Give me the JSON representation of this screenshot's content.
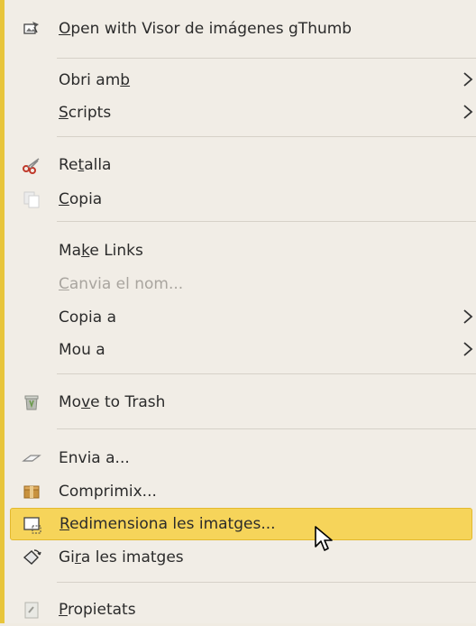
{
  "menu": {
    "items": [
      {
        "pre": "",
        "u": "O",
        "post": "pen with Visor de imágenes gThumb",
        "icon": "gthumb-icon"
      },
      {
        "pre": "Obri am",
        "u": "b",
        "post": "",
        "submenu": true
      },
      {
        "pre": "",
        "u": "S",
        "post": "cripts",
        "submenu": true
      },
      {
        "pre": "Re",
        "u": "t",
        "post": "alla",
        "icon": "scissors-icon"
      },
      {
        "pre": "",
        "u": "C",
        "post": "opia",
        "icon": "copy-icon"
      },
      {
        "pre": "Ma",
        "u": "k",
        "post": "e Links"
      },
      {
        "pre": "",
        "u": "C",
        "post": "anvia el nom...",
        "disabled": true
      },
      {
        "pre": "Copia a",
        "u": "",
        "post": "",
        "submenu": true
      },
      {
        "pre": "Mou a",
        "u": "",
        "post": "",
        "submenu": true
      },
      {
        "pre": "Mo",
        "u": "v",
        "post": "e to Trash",
        "icon": "trash-icon"
      },
      {
        "pre": "Envia a...",
        "u": "",
        "post": "",
        "icon": "send-icon"
      },
      {
        "pre": "Comprimix...",
        "u": "",
        "post": "",
        "icon": "archive-icon"
      },
      {
        "pre": "",
        "u": "R",
        "post": "edimensiona les imatges...",
        "icon": "resize-icon",
        "highlighted": true
      },
      {
        "pre": "Gi",
        "u": "r",
        "post": "a les imatges",
        "icon": "rotate-icon"
      },
      {
        "pre": "",
        "u": "P",
        "post": "ropietats",
        "icon": "properties-icon"
      }
    ]
  },
  "colors": {
    "background": "#f1ede6",
    "highlight": "#f6d45a",
    "accent_border": "#e8c53b",
    "disabled_text": "#a9a59f"
  }
}
